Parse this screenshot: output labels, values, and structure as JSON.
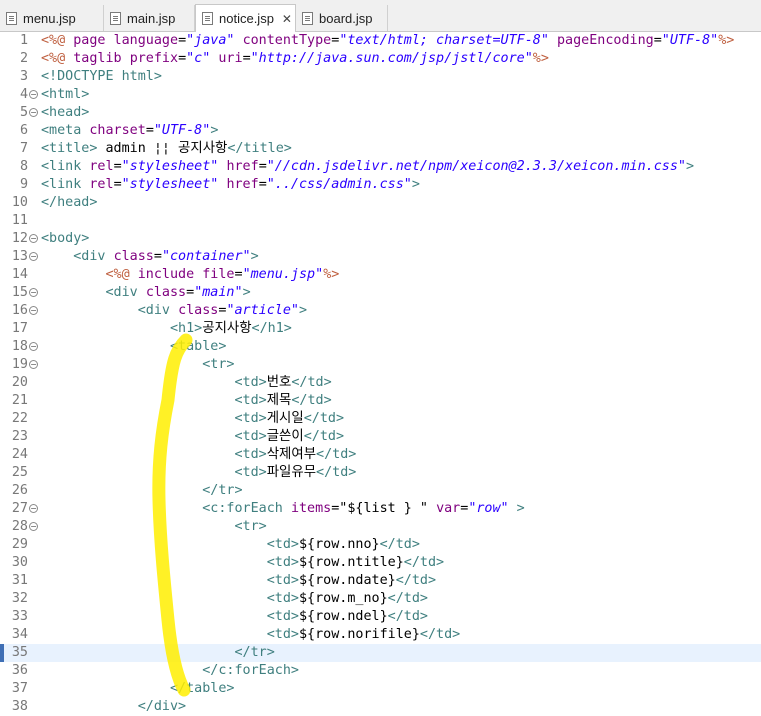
{
  "tabs": [
    {
      "label": "menu.jsp",
      "active": false,
      "closable": false
    },
    {
      "label": "main.jsp",
      "active": false,
      "closable": false
    },
    {
      "label": "notice.jsp",
      "active": true,
      "closable": true
    },
    {
      "label": "board.jsp",
      "active": false,
      "closable": false
    }
  ],
  "close_glyph": "✕",
  "colors": {
    "tag": "#3f7f7f",
    "attribute": "#7f007f",
    "value": "#2a00ff",
    "text": "#000000",
    "directive": "#bf5f3f",
    "current_line": "#e8f2fe",
    "highlighter": "#ffef00"
  },
  "current_line": 35,
  "lines": [
    {
      "n": "1",
      "fold": false,
      "segs": [
        [
          "d",
          "<%@ "
        ],
        [
          "a",
          "page "
        ],
        [
          "a",
          "language"
        ],
        [
          "x",
          "="
        ],
        [
          "v",
          "\"java\""
        ],
        [
          "x",
          " "
        ],
        [
          "a",
          "contentType"
        ],
        [
          "x",
          "="
        ],
        [
          "v",
          "\"text/html; charset=UTF-8\""
        ],
        [
          "x",
          " "
        ],
        [
          "a",
          "pageEncoding"
        ],
        [
          "x",
          "="
        ],
        [
          "v",
          "\"UTF-8\""
        ],
        [
          "d",
          "%>"
        ]
      ]
    },
    {
      "n": "2",
      "fold": false,
      "segs": [
        [
          "d",
          "<%@ "
        ],
        [
          "a",
          "taglib "
        ],
        [
          "a",
          "prefix"
        ],
        [
          "x",
          "="
        ],
        [
          "v",
          "\"c\""
        ],
        [
          "x",
          " "
        ],
        [
          "a",
          "uri"
        ],
        [
          "x",
          "="
        ],
        [
          "v",
          "\"http://java.sun.com/jsp/jstl/core\""
        ],
        [
          "d",
          "%>"
        ]
      ]
    },
    {
      "n": "3",
      "fold": false,
      "segs": [
        [
          "t",
          "<!DOCTYPE html>"
        ]
      ]
    },
    {
      "n": "4",
      "fold": true,
      "segs": [
        [
          "t",
          "<html>"
        ]
      ]
    },
    {
      "n": "5",
      "fold": true,
      "segs": [
        [
          "t",
          "<head>"
        ]
      ]
    },
    {
      "n": "6",
      "fold": false,
      "segs": [
        [
          "t",
          "<meta "
        ],
        [
          "a",
          "charset"
        ],
        [
          "x",
          "="
        ],
        [
          "v",
          "\"UTF-8\""
        ],
        [
          "t",
          ">"
        ]
      ]
    },
    {
      "n": "7",
      "fold": false,
      "segs": [
        [
          "t",
          "<title>"
        ],
        [
          "x",
          " admin ¦¦ 공지사항"
        ],
        [
          "t",
          "</title>"
        ]
      ]
    },
    {
      "n": "8",
      "fold": false,
      "segs": [
        [
          "t",
          "<link "
        ],
        [
          "a",
          "rel"
        ],
        [
          "x",
          "="
        ],
        [
          "v",
          "\"stylesheet\""
        ],
        [
          "x",
          " "
        ],
        [
          "a",
          "href"
        ],
        [
          "x",
          "="
        ],
        [
          "v",
          "\"//cdn.jsdelivr.net/npm/xeicon@2.3.3/xeicon.min.css\""
        ],
        [
          "t",
          ">"
        ]
      ]
    },
    {
      "n": "9",
      "fold": false,
      "segs": [
        [
          "t",
          "<link "
        ],
        [
          "a",
          "rel"
        ],
        [
          "x",
          "="
        ],
        [
          "v",
          "\"stylesheet\""
        ],
        [
          "x",
          " "
        ],
        [
          "a",
          "href"
        ],
        [
          "x",
          "="
        ],
        [
          "v",
          "\"../css/admin.css\""
        ],
        [
          "t",
          ">"
        ]
      ]
    },
    {
      "n": "10",
      "fold": false,
      "segs": [
        [
          "t",
          "</head>"
        ]
      ]
    },
    {
      "n": "11",
      "fold": false,
      "segs": []
    },
    {
      "n": "12",
      "fold": true,
      "segs": [
        [
          "t",
          "<body>"
        ]
      ]
    },
    {
      "n": "13",
      "fold": true,
      "segs": [
        [
          "x",
          "    "
        ],
        [
          "t",
          "<div "
        ],
        [
          "a",
          "class"
        ],
        [
          "x",
          "="
        ],
        [
          "v",
          "\"container\""
        ],
        [
          "t",
          ">"
        ]
      ]
    },
    {
      "n": "14",
      "fold": false,
      "segs": [
        [
          "x",
          "        "
        ],
        [
          "d",
          "<%@ "
        ],
        [
          "a",
          "include "
        ],
        [
          "a",
          "file"
        ],
        [
          "x",
          "="
        ],
        [
          "v",
          "\"menu.jsp\""
        ],
        [
          "d",
          "%>"
        ]
      ]
    },
    {
      "n": "15",
      "fold": true,
      "segs": [
        [
          "x",
          "        "
        ],
        [
          "t",
          "<div "
        ],
        [
          "a",
          "class"
        ],
        [
          "x",
          "="
        ],
        [
          "v",
          "\"main\""
        ],
        [
          "t",
          ">"
        ]
      ]
    },
    {
      "n": "16",
      "fold": true,
      "segs": [
        [
          "x",
          "            "
        ],
        [
          "t",
          "<div "
        ],
        [
          "a",
          "class"
        ],
        [
          "x",
          "="
        ],
        [
          "v",
          "\"article\""
        ],
        [
          "t",
          ">"
        ]
      ]
    },
    {
      "n": "17",
      "fold": false,
      "segs": [
        [
          "x",
          "                "
        ],
        [
          "t",
          "<h1>"
        ],
        [
          "x",
          "공지사항"
        ],
        [
          "t",
          "</h1>"
        ]
      ]
    },
    {
      "n": "18",
      "fold": true,
      "segs": [
        [
          "x",
          "                "
        ],
        [
          "t",
          "<table>"
        ]
      ]
    },
    {
      "n": "19",
      "fold": true,
      "segs": [
        [
          "x",
          "                    "
        ],
        [
          "t",
          "<tr>"
        ]
      ]
    },
    {
      "n": "20",
      "fold": false,
      "segs": [
        [
          "x",
          "                        "
        ],
        [
          "t",
          "<td>"
        ],
        [
          "x",
          "번호"
        ],
        [
          "t",
          "</td>"
        ]
      ]
    },
    {
      "n": "21",
      "fold": false,
      "segs": [
        [
          "x",
          "                        "
        ],
        [
          "t",
          "<td>"
        ],
        [
          "x",
          "제목"
        ],
        [
          "t",
          "</td>"
        ]
      ]
    },
    {
      "n": "22",
      "fold": false,
      "segs": [
        [
          "x",
          "                        "
        ],
        [
          "t",
          "<td>"
        ],
        [
          "x",
          "게시일"
        ],
        [
          "t",
          "</td>"
        ]
      ]
    },
    {
      "n": "23",
      "fold": false,
      "segs": [
        [
          "x",
          "                        "
        ],
        [
          "t",
          "<td>"
        ],
        [
          "x",
          "글쓴이"
        ],
        [
          "t",
          "</td>"
        ]
      ]
    },
    {
      "n": "24",
      "fold": false,
      "segs": [
        [
          "x",
          "                        "
        ],
        [
          "t",
          "<td>"
        ],
        [
          "x",
          "삭제여부"
        ],
        [
          "t",
          "</td>"
        ]
      ]
    },
    {
      "n": "25",
      "fold": false,
      "segs": [
        [
          "x",
          "                        "
        ],
        [
          "t",
          "<td>"
        ],
        [
          "x",
          "파일유무"
        ],
        [
          "t",
          "</td>"
        ]
      ]
    },
    {
      "n": "26",
      "fold": false,
      "segs": [
        [
          "x",
          "                    "
        ],
        [
          "t",
          "</tr>"
        ]
      ]
    },
    {
      "n": "27",
      "fold": true,
      "segs": [
        [
          "x",
          "                    "
        ],
        [
          "t",
          "<c:forEach "
        ],
        [
          "a",
          "items"
        ],
        [
          "x",
          "=\"${list } \" "
        ],
        [
          "a",
          "var"
        ],
        [
          "x",
          "="
        ],
        [
          "v",
          "\"row\""
        ],
        [
          "t",
          " >"
        ]
      ]
    },
    {
      "n": "28",
      "fold": true,
      "segs": [
        [
          "x",
          "                        "
        ],
        [
          "t",
          "<tr>"
        ]
      ]
    },
    {
      "n": "29",
      "fold": false,
      "segs": [
        [
          "x",
          "                            "
        ],
        [
          "t",
          "<td>"
        ],
        [
          "x",
          "${row.nno}"
        ],
        [
          "t",
          "</td>"
        ]
      ]
    },
    {
      "n": "30",
      "fold": false,
      "segs": [
        [
          "x",
          "                            "
        ],
        [
          "t",
          "<td>"
        ],
        [
          "x",
          "${row.ntitle}"
        ],
        [
          "t",
          "</td>"
        ]
      ]
    },
    {
      "n": "31",
      "fold": false,
      "segs": [
        [
          "x",
          "                            "
        ],
        [
          "t",
          "<td>"
        ],
        [
          "x",
          "${row.ndate}"
        ],
        [
          "t",
          "</td>"
        ]
      ]
    },
    {
      "n": "32",
      "fold": false,
      "segs": [
        [
          "x",
          "                            "
        ],
        [
          "t",
          "<td>"
        ],
        [
          "x",
          "${row.m_no}"
        ],
        [
          "t",
          "</td>"
        ]
      ]
    },
    {
      "n": "33",
      "fold": false,
      "segs": [
        [
          "x",
          "                            "
        ],
        [
          "t",
          "<td>"
        ],
        [
          "x",
          "${row.ndel}"
        ],
        [
          "t",
          "</td>"
        ]
      ]
    },
    {
      "n": "34",
      "fold": false,
      "segs": [
        [
          "x",
          "                            "
        ],
        [
          "t",
          "<td>"
        ],
        [
          "x",
          "${row.norifile}"
        ],
        [
          "t",
          "</td>"
        ]
      ]
    },
    {
      "n": "35",
      "fold": false,
      "segs": [
        [
          "x",
          "                        "
        ],
        [
          "t",
          "</tr>"
        ]
      ]
    },
    {
      "n": "36",
      "fold": false,
      "segs": [
        [
          "x",
          "                    "
        ],
        [
          "t",
          "</c:forEach>"
        ]
      ]
    },
    {
      "n": "37",
      "fold": false,
      "segs": [
        [
          "x",
          "                "
        ],
        [
          "t",
          "</table>"
        ]
      ]
    },
    {
      "n": "38",
      "fold": false,
      "segs": [
        [
          "x",
          "            "
        ],
        [
          "t",
          "</div>"
        ]
      ]
    }
  ]
}
